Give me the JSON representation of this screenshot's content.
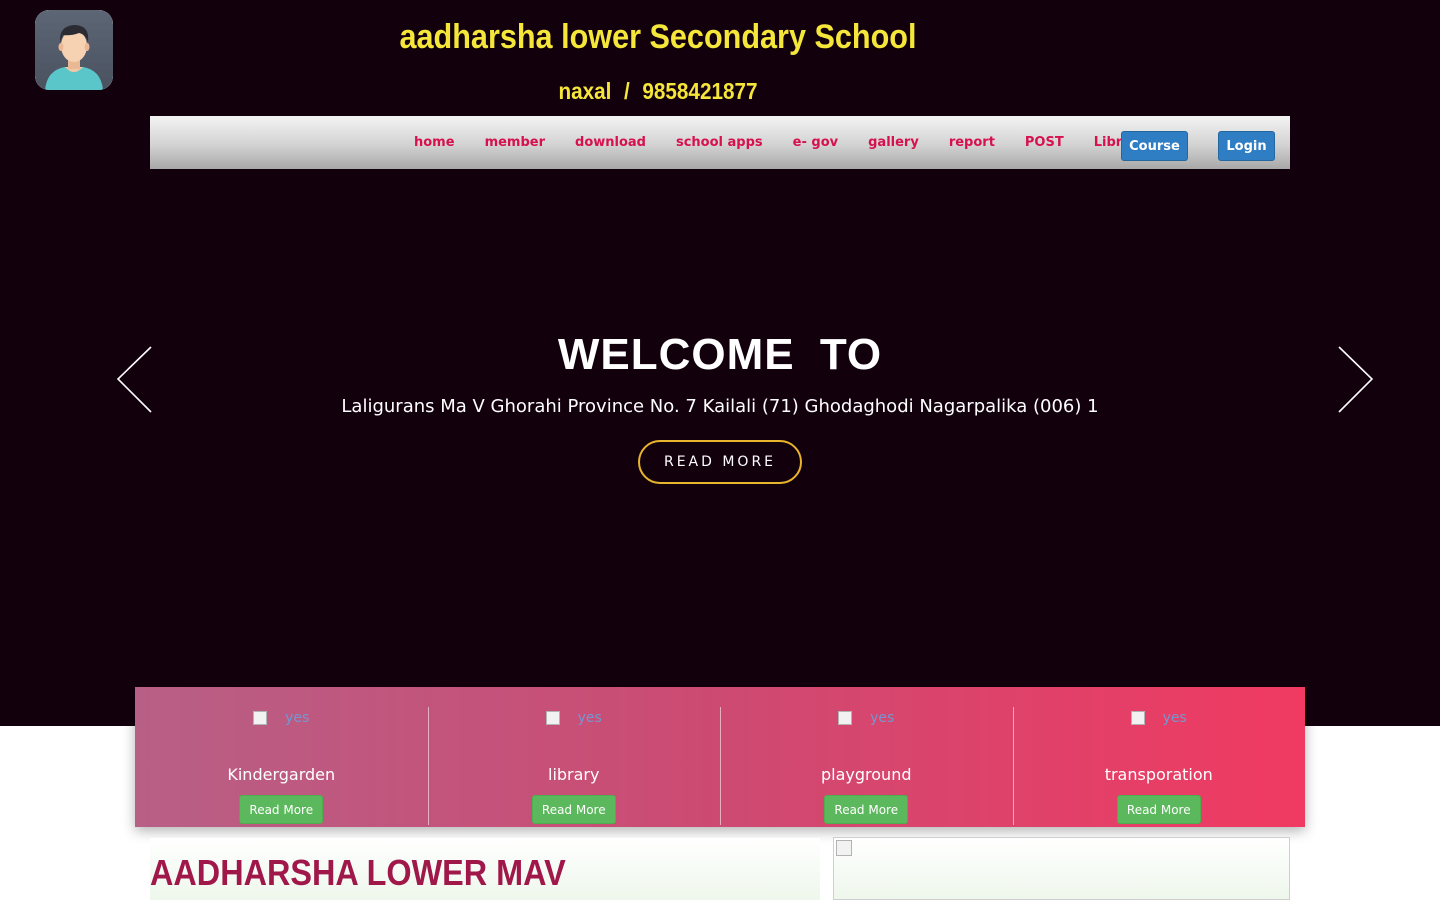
{
  "header": {
    "school_name": "aadharsha lower Secondary School",
    "location": "naxal",
    "separator": "/",
    "phone": "9858421877"
  },
  "nav": {
    "links": [
      "home",
      "member",
      "download",
      "school apps",
      "e- gov",
      "gallery",
      "report",
      "POST",
      "Library"
    ],
    "course_button": "Course",
    "login_button": "Login"
  },
  "hero": {
    "welcome": "WELCOME  TO",
    "address": "Laligurans Ma V Ghorahi Province No. 7 Kailali (71) Ghodaghodi Nagarpalika (006) 1",
    "read_more": "READ MORE",
    "prev_icon": "chevron-left-icon",
    "next_icon": "chevron-right-icon"
  },
  "services": [
    {
      "image_alt": "yes",
      "title": "Kindergarden",
      "button": "Read More"
    },
    {
      "image_alt": "yes",
      "title": "library",
      "button": "Read More"
    },
    {
      "image_alt": "yes",
      "title": "playground",
      "button": "Read More"
    },
    {
      "image_alt": "yes",
      "title": "transporation",
      "button": "Read More"
    }
  ],
  "about": {
    "heading": "AADHARSHA LOWER MAV"
  },
  "colors": {
    "hero_bg": "#13000d",
    "header_text": "#f5e63a",
    "nav_link": "#d6114d",
    "nav_button": "#2f7dc3",
    "hero_button_border": "#e9b52c",
    "services_gradient_start": "#b85f86",
    "services_gradient_end": "#f03a62",
    "service_button": "#5cb85c",
    "about_heading": "#a0184a"
  }
}
